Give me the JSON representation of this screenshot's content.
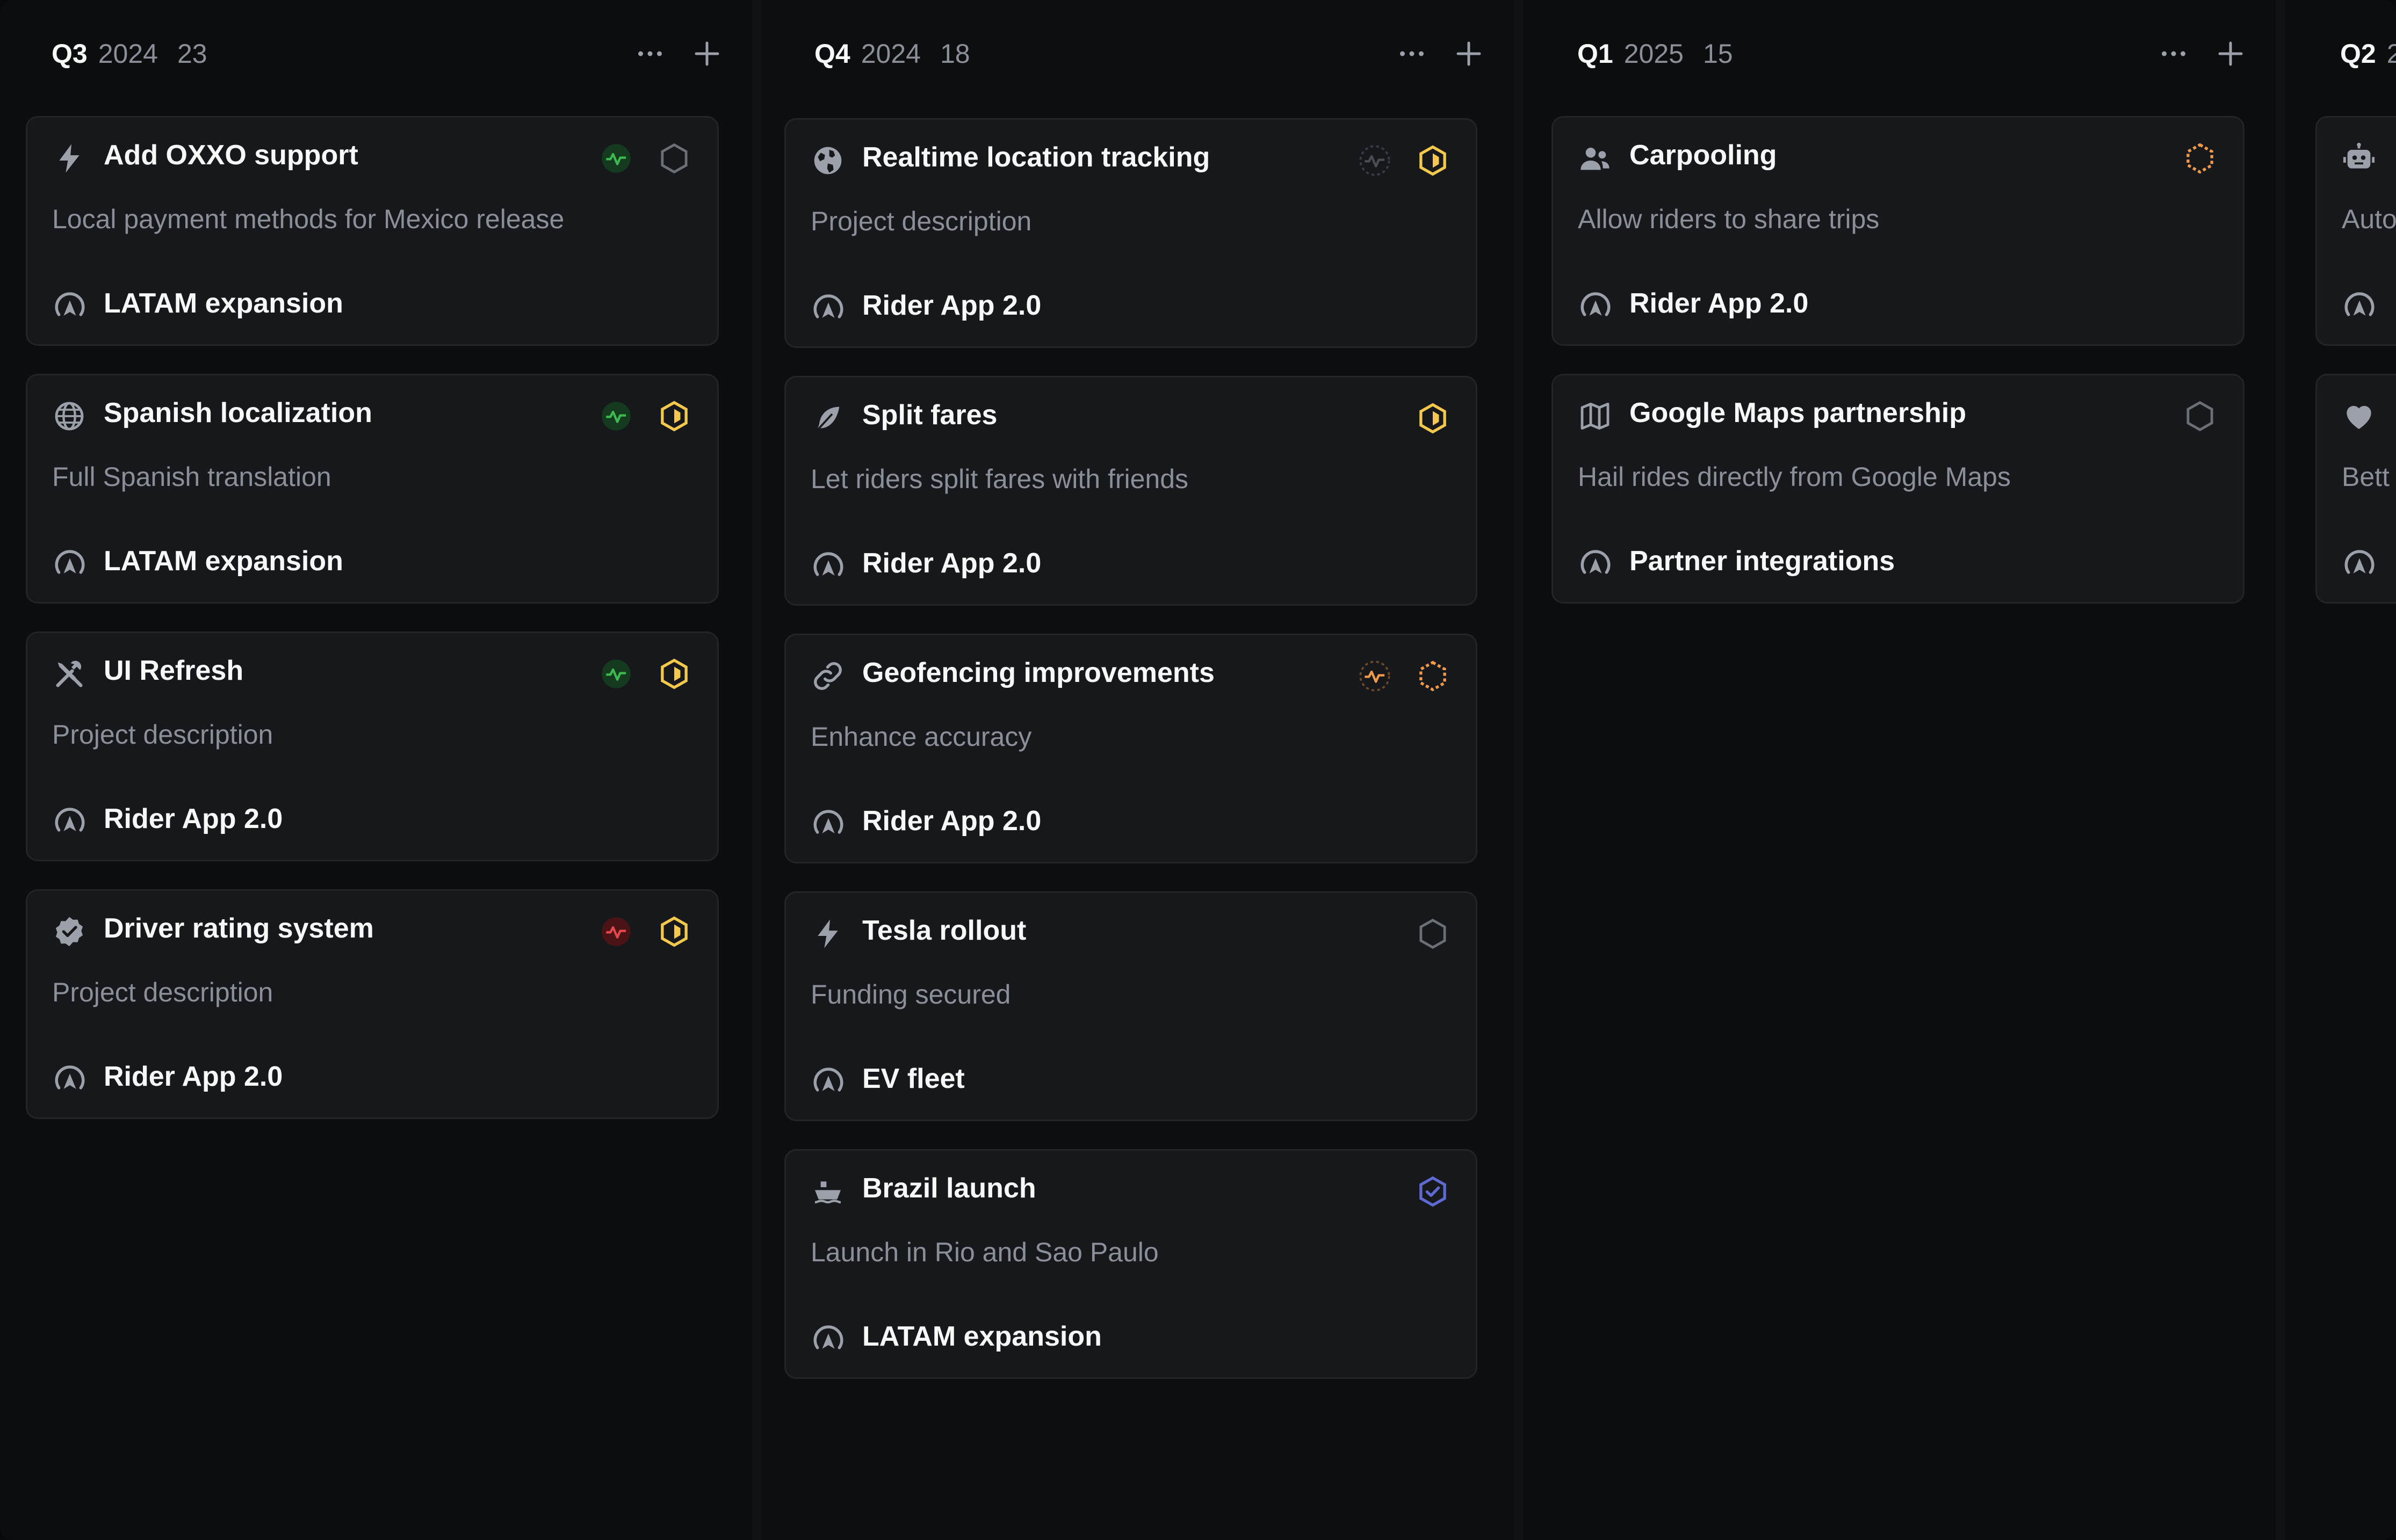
{
  "columns": [
    {
      "quarter": "Q3",
      "year": "2024",
      "count": "23",
      "cards": [
        {
          "title": "Add OXXO support",
          "description": "Local payment methods for Mexico release",
          "initiative": "LATAM expansion",
          "icon": "bolt-icon",
          "health": "on-track",
          "status": "backlog"
        },
        {
          "title": "Spanish localization",
          "description": "Full Spanish translation",
          "initiative": "LATAM expansion",
          "icon": "globe-icon",
          "health": "on-track",
          "status": "in-progress"
        },
        {
          "title": "UI Refresh",
          "description": "Project description",
          "initiative": "Rider App 2.0",
          "icon": "tools-icon",
          "health": "on-track",
          "status": "in-progress"
        },
        {
          "title": "Driver rating system",
          "description": "Project description",
          "initiative": "Rider App 2.0",
          "icon": "verified-badge-icon",
          "health": "off-track",
          "status": "in-progress"
        }
      ]
    },
    {
      "quarter": "Q4",
      "year": "2024",
      "count": "18",
      "cards": [
        {
          "title": "Realtime location tracking",
          "description": "Project description",
          "initiative": "Rider App 2.0",
          "icon": "earth-icon",
          "health": "no-update",
          "status": "in-progress"
        },
        {
          "title": "Split fares",
          "description": "Let riders split fares with friends",
          "initiative": "Rider App 2.0",
          "icon": "feather-icon",
          "health": "",
          "status": "in-progress"
        },
        {
          "title": "Geofencing improvements",
          "description": "Enhance accuracy",
          "initiative": "Rider App 2.0",
          "icon": "link-icon",
          "health": "at-risk",
          "status": "planned"
        },
        {
          "title": "Tesla rollout",
          "description": "Funding secured",
          "initiative": "EV fleet",
          "icon": "bolt-icon",
          "health": "",
          "status": "backlog"
        },
        {
          "title": "Brazil launch",
          "description": "Launch in Rio and Sao Paulo",
          "initiative": "LATAM expansion",
          "icon": "ship-icon",
          "health": "",
          "status": "completed"
        }
      ]
    },
    {
      "quarter": "Q1",
      "year": "2025",
      "count": "15",
      "cards": [
        {
          "title": "Carpooling",
          "description": "Allow riders to share trips",
          "initiative": "Rider App 2.0",
          "icon": "people-icon",
          "health": "",
          "status": "planned"
        },
        {
          "title": "Google Maps partnership",
          "description": "Hail rides directly from Google Maps",
          "initiative": "Partner integrations",
          "icon": "map-icon",
          "health": "",
          "status": "backlog"
        }
      ]
    },
    {
      "quarter": "Q2",
      "year": "2",
      "count": "",
      "cards": [
        {
          "title": "",
          "description": "Auto",
          "initiative": "",
          "icon": "robot-icon",
          "health": "",
          "status": ""
        },
        {
          "title": "",
          "description": "Bett",
          "initiative": "",
          "icon": "heart-icon",
          "health": "",
          "status": ""
        }
      ]
    }
  ],
  "colors": {
    "on_track": "#3fb950",
    "off_track": "#e5484d",
    "at_risk": "#f2994a",
    "in_progress": "#f2c94c",
    "planned": "#f2994a",
    "completed": "#5e6ad2",
    "backlog": "#6b6f76"
  }
}
